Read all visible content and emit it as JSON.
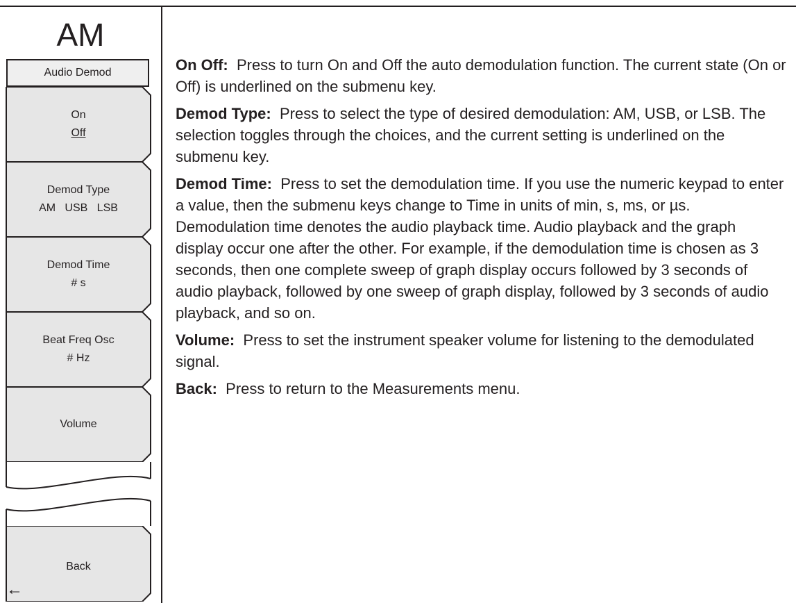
{
  "menu": {
    "title": "AM",
    "header": "Audio Demod",
    "keys": [
      {
        "line1": "On",
        "line2": "Off"
      },
      {
        "line1": "Demod Type",
        "line2": "AM   USB   LSB"
      },
      {
        "line1": "Demod Time",
        "line2": "# s"
      },
      {
        "line1": "Beat Freq Osc",
        "line2": "# Hz"
      },
      {
        "line1": "Volume"
      }
    ],
    "back": {
      "label": "Back",
      "arrow": "←"
    }
  },
  "descriptions": [
    {
      "term": "On  Off:",
      "text": "Press to turn On and Off the auto demodulation function. The current state (On or Off) is underlined on the submenu key."
    },
    {
      "term": "Demod Type:",
      "text": "Press to select the type of desired demodulation:  AM, USB, or LSB. The selection toggles through the choices, and the current setting is underlined on the submenu key."
    },
    {
      "term": "Demod Time:",
      "text": "Press to set the demodulation time. If you use the numeric keypad to enter a value, then the submenu keys change to Time in units of min, s, ms, or µs. Demodulation time denotes the audio playback time. Audio playback and the graph display occur one after the other. For example, if the demodulation time is chosen as 3 seconds, then one complete sweep of graph display occurs followed by 3 seconds of audio playback, followed by one sweep of graph display, followed by 3 seconds of audio playback, and so on."
    },
    {
      "term": "Volume:",
      "text": "Press to set the instrument speaker volume for listening to the demodulated signal."
    },
    {
      "term": "Back:",
      "text": "Press to return to the Measurements menu."
    }
  ]
}
